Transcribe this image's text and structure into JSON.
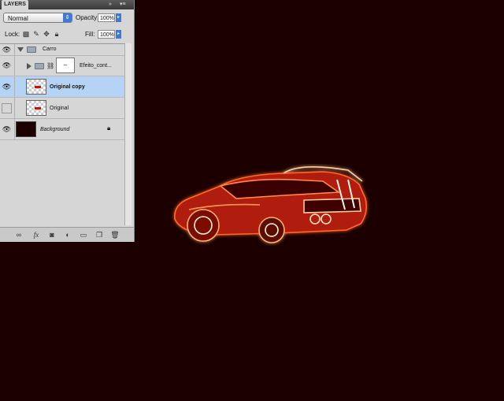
{
  "panel": {
    "tab_label": "LAYERS",
    "collapse_glyph": "»",
    "menu_glyph": "▾≡",
    "blend_mode": "Normal",
    "opacity_label": "Opacity:",
    "opacity_value": "100%",
    "lock_label": "Lock:",
    "fill_label": "Fill:",
    "fill_value": "100%"
  },
  "layers": [
    {
      "name": "Carro",
      "kind": "group",
      "visible": true,
      "expanded": true
    },
    {
      "name": "Efeito_cont...",
      "kind": "group-masked",
      "visible": true,
      "expanded": false,
      "mask_glyph": "–"
    },
    {
      "name": "Original copy",
      "kind": "pixel",
      "visible": true,
      "selected": true
    },
    {
      "name": "Original",
      "kind": "pixel",
      "visible": false,
      "selected": false
    },
    {
      "name": "Background",
      "kind": "background",
      "visible": true,
      "locked": true
    }
  ],
  "bottom_icons": [
    "link-icon",
    "fx-icon",
    "mask-icon",
    "adjustment-icon",
    "folder-icon",
    "new-layer-icon",
    "trash-icon"
  ],
  "colors": {
    "canvas_bg": "#1c0000",
    "selected_row": "#b4d3f5",
    "accent": "#3b7ad9",
    "glow": "#ff5a1e"
  }
}
